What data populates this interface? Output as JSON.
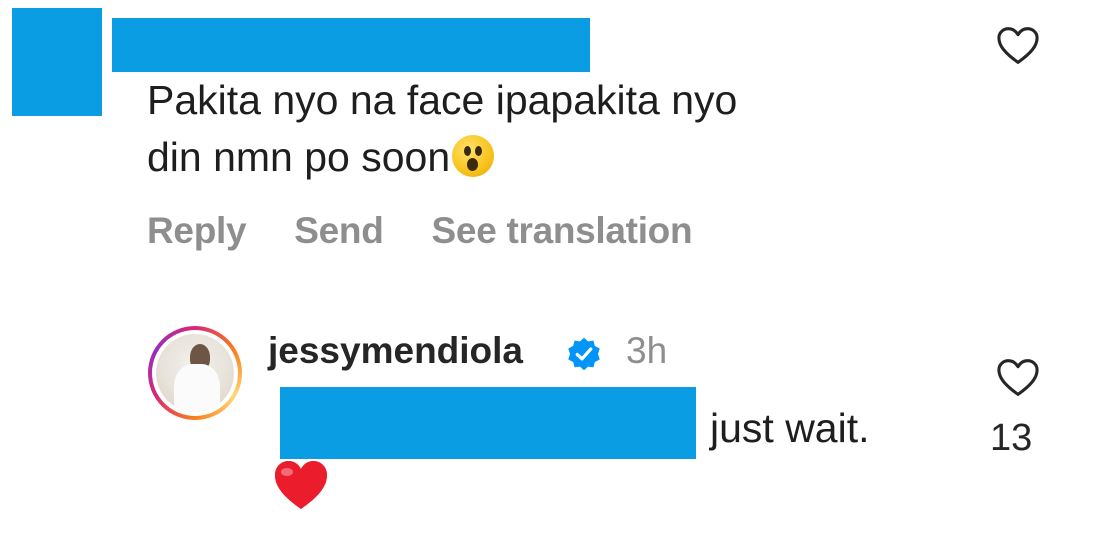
{
  "top_comment": {
    "text_line1": "Pakita nyo na face ipapakita nyo",
    "text_line2": "din nmn po soon",
    "actions": {
      "reply_label": "Reply",
      "send_label": "Send",
      "translate_label": "See translation"
    }
  },
  "reply": {
    "username": "jessymendiola",
    "time": "3h",
    "text": "just wait.",
    "like_count": "13"
  },
  "icons": {
    "like": "heart-outline-icon",
    "verified": "verified-badge-icon",
    "shock_emoji": "astonished-face-emoji",
    "heart_emoji": "red-heart-emoji"
  },
  "colors": {
    "redaction": "#0a9de3",
    "verified": "#0095f6",
    "muted_text": "#8e8e8e"
  }
}
